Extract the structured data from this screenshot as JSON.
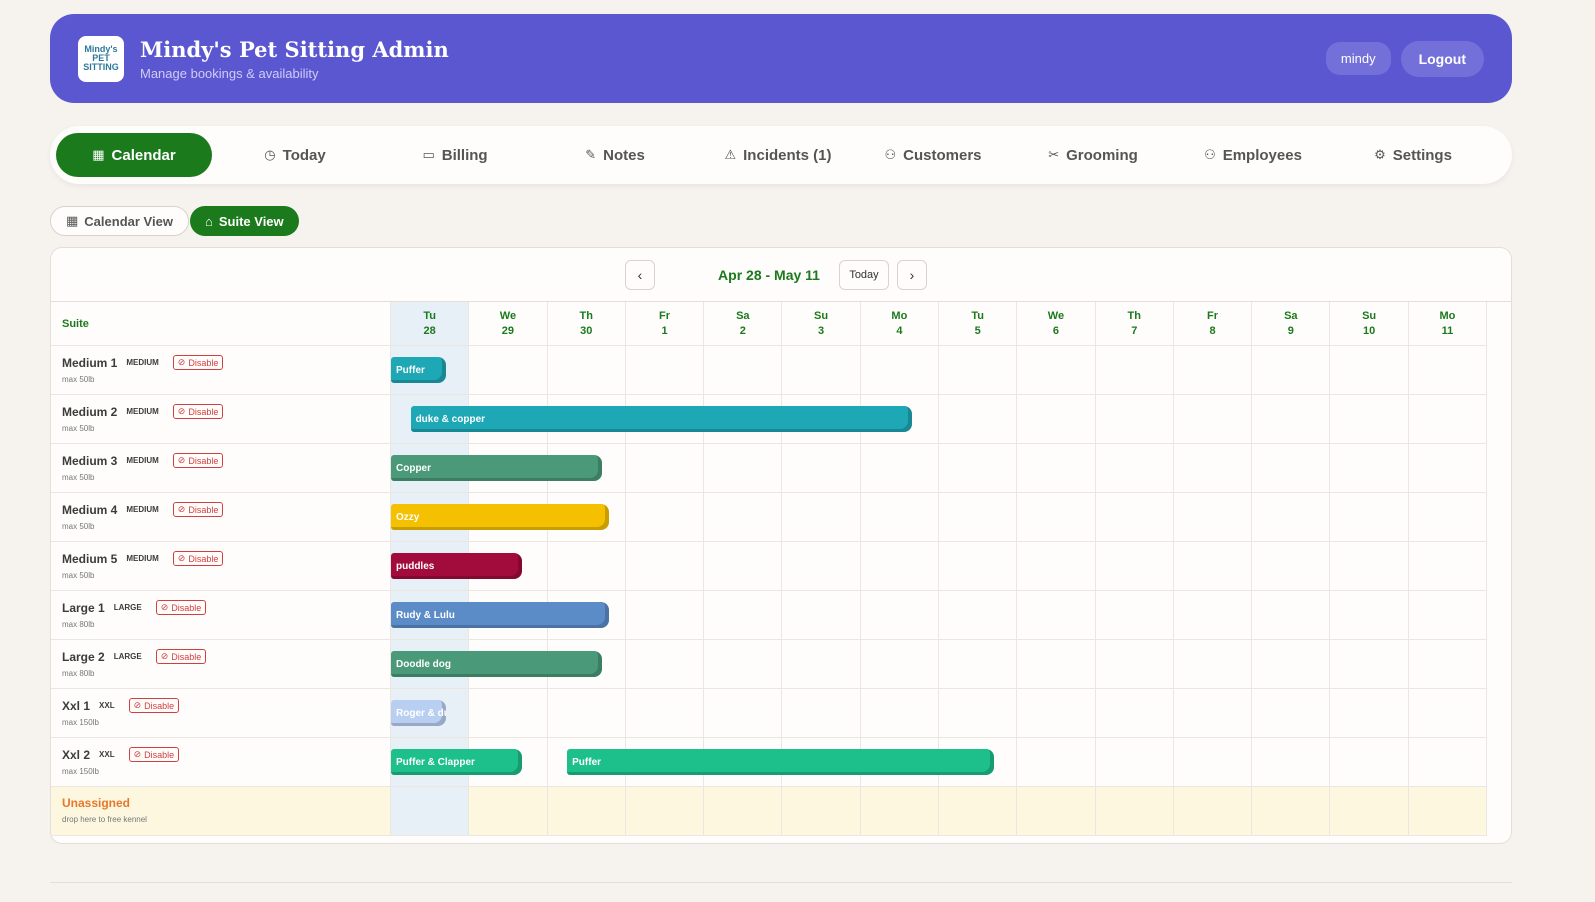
{
  "header": {
    "logo_text": "Mindy's PET SITTING",
    "title": "Mindy's Pet Sitting Admin",
    "subtitle": "Manage bookings & availability",
    "user": "mindy",
    "logout_label": "Logout",
    "accent_color": "#5b57d0"
  },
  "nav": {
    "items": [
      {
        "label": "Calendar",
        "icon": "calendar-icon",
        "glyph": "▦",
        "active": true
      },
      {
        "label": "Today",
        "icon": "clock-icon",
        "glyph": "◷"
      },
      {
        "label": "Billing",
        "icon": "credit-card-icon",
        "glyph": "▭"
      },
      {
        "label": "Notes",
        "icon": "pencil-icon",
        "glyph": "✎"
      },
      {
        "label": "Incidents (1)",
        "icon": "warning-icon",
        "glyph": "⚠"
      },
      {
        "label": "Customers",
        "icon": "users-icon",
        "glyph": "⚇"
      },
      {
        "label": "Grooming",
        "icon": "scissors-icon",
        "glyph": "✂"
      },
      {
        "label": "Employees",
        "icon": "users-icon",
        "glyph": "⚇"
      },
      {
        "label": "Settings",
        "icon": "gear-icon",
        "glyph": "⚙"
      }
    ],
    "active_color": "#1a7a1c"
  },
  "views": {
    "calendar_label": "Calendar View",
    "suite_label": "Suite View",
    "active": "suite"
  },
  "calendar": {
    "range_label": "Apr 28 - May 11",
    "today_label": "Today",
    "prev_icon": "‹",
    "next_icon": "›",
    "suite_header": "Suite",
    "days": [
      {
        "dow": "Tu",
        "date": "28",
        "today": true
      },
      {
        "dow": "We",
        "date": "29"
      },
      {
        "dow": "Th",
        "date": "30"
      },
      {
        "dow": "Fr",
        "date": "1"
      },
      {
        "dow": "Sa",
        "date": "2"
      },
      {
        "dow": "Su",
        "date": "3"
      },
      {
        "dow": "Mo",
        "date": "4"
      },
      {
        "dow": "Tu",
        "date": "5"
      },
      {
        "dow": "We",
        "date": "6"
      },
      {
        "dow": "Th",
        "date": "7"
      },
      {
        "dow": "Fr",
        "date": "8"
      },
      {
        "dow": "Sa",
        "date": "9"
      },
      {
        "dow": "Su",
        "date": "10"
      },
      {
        "dow": "Mo",
        "date": "11"
      }
    ],
    "disable_label": "Disable",
    "suites": [
      {
        "name": "Medium 1",
        "size": "MEDIUM",
        "max": "max 50lb"
      },
      {
        "name": "Medium 2",
        "size": "MEDIUM",
        "max": "max 50lb"
      },
      {
        "name": "Medium 3",
        "size": "MEDIUM",
        "max": "max 50lb"
      },
      {
        "name": "Medium 4",
        "size": "MEDIUM",
        "max": "max 50lb"
      },
      {
        "name": "Medium 5",
        "size": "MEDIUM",
        "max": "max 50lb"
      },
      {
        "name": "Large 1",
        "size": "LARGE",
        "max": "max 80lb"
      },
      {
        "name": "Large 2",
        "size": "LARGE",
        "max": "max 80lb"
      },
      {
        "name": "Xxl 1",
        "size": "XXL",
        "max": "max 150lb"
      },
      {
        "name": "Xxl 2",
        "size": "XXL",
        "max": "max 150lb"
      }
    ],
    "unassigned": {
      "title": "Unassigned",
      "subtitle": "drop here to free kennel"
    },
    "bookings": [
      {
        "suite": 0,
        "start": 0,
        "end": 0.7,
        "label": "Puffer",
        "color": "#1ea7b5"
      },
      {
        "suite": 1,
        "start": 0.25,
        "end": 6.65,
        "label": "duke & copper",
        "color": "#1ea7b5"
      },
      {
        "suite": 2,
        "start": 0,
        "end": 2.7,
        "label": "Copper",
        "color": "#4a9a7a"
      },
      {
        "suite": 3,
        "start": 0,
        "end": 2.78,
        "label": "Ozzy",
        "color": "#f5c000"
      },
      {
        "suite": 4,
        "start": 0,
        "end": 1.67,
        "label": "puddles",
        "color": "#a20c3c"
      },
      {
        "suite": 5,
        "start": 0,
        "end": 2.78,
        "label": "Rudy & Lulu",
        "color": "#5b8cc7"
      },
      {
        "suite": 6,
        "start": 0,
        "end": 2.7,
        "label": "Doodle dog",
        "color": "#4a9a7a"
      },
      {
        "suite": 7,
        "start": 0,
        "end": 0.7,
        "label": "Roger & duke",
        "color": "#b9cff2"
      },
      {
        "suite": 8,
        "start": 0,
        "end": 1.67,
        "label": "Puffer & Clapper",
        "color": "#1dbf8a"
      },
      {
        "suite": 8,
        "start": 2.25,
        "end": 7.7,
        "label": "Puffer",
        "color": "#1dbf8a"
      }
    ]
  }
}
